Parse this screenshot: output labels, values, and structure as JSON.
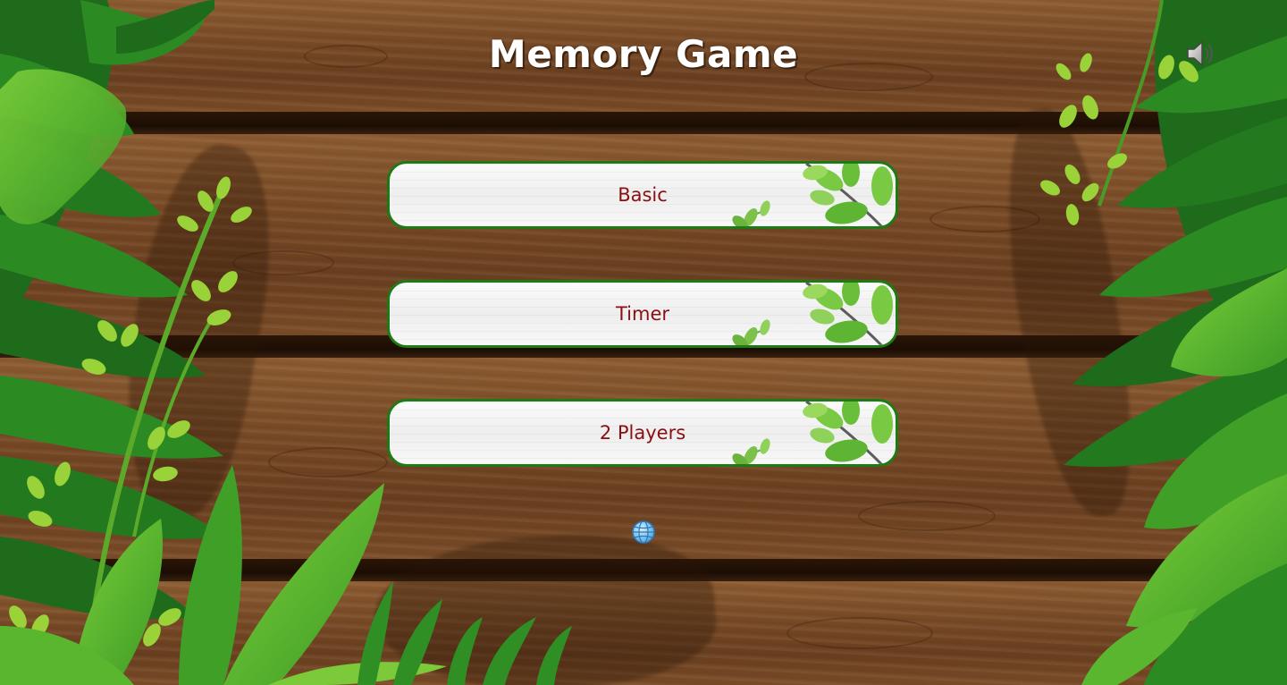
{
  "header": {
    "title": "Memory Game"
  },
  "menu": {
    "buttons": [
      {
        "label": "Basic"
      },
      {
        "label": "Timer"
      },
      {
        "label": "2 Players"
      }
    ]
  },
  "controls": {
    "sound_icon": "speaker-icon",
    "language_icon": "globe-icon"
  },
  "colors": {
    "button_text": "#8a0f12",
    "button_border": "#1d7a14",
    "title_text": "#ffffff",
    "wood": "#7a4b26",
    "leaf_dark": "#1f6b1c",
    "leaf_light": "#6cc02c"
  }
}
